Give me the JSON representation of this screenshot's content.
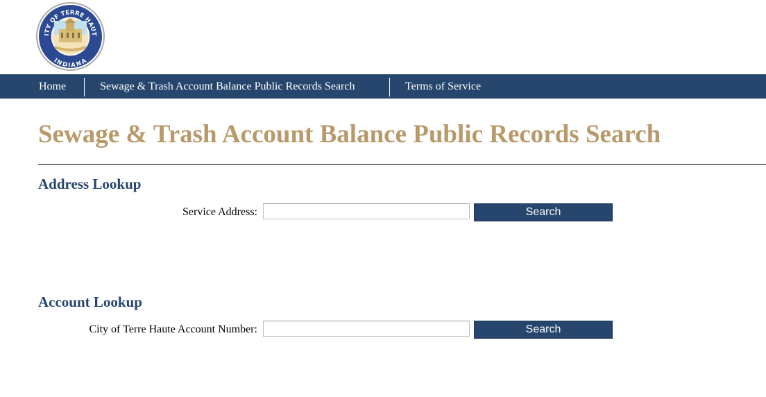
{
  "header": {
    "logo": {
      "icon": "city-seal-icon",
      "top_text": "CITY OF TERRE HAUTE",
      "bottom_text": "INDIANA"
    }
  },
  "nav": {
    "items": [
      {
        "label": "Home"
      },
      {
        "label": "Sewage & Trash Account Balance Public Records Search"
      },
      {
        "label": "Terms of Service"
      }
    ]
  },
  "page": {
    "title": "Sewage & Trash Account Balance Public Records Search"
  },
  "address_lookup": {
    "heading": "Address Lookup",
    "label": "Service Address:",
    "value": "",
    "button": "Search"
  },
  "account_lookup": {
    "heading": "Account Lookup",
    "label": "City of Terre Haute Account Number:",
    "value": "",
    "button": "Search"
  },
  "colors": {
    "brand_navy": "#26466d",
    "title_gold": "#b8996a"
  }
}
